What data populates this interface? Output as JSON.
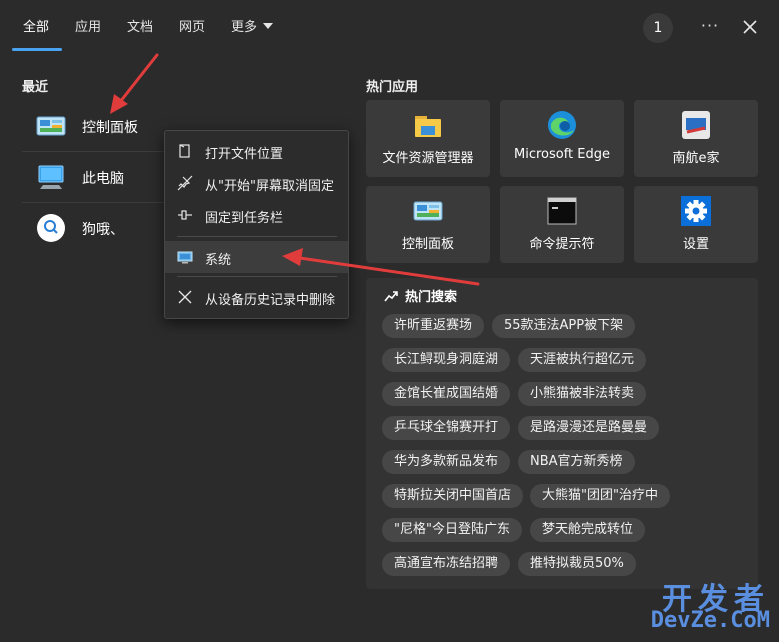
{
  "tabs": [
    {
      "label": "全部"
    },
    {
      "label": "应用"
    },
    {
      "label": "文档"
    },
    {
      "label": "网页"
    },
    {
      "label": "更多"
    }
  ],
  "topbar": {
    "badge": "1",
    "more": "···"
  },
  "recent": {
    "title": "最近",
    "items": [
      {
        "label": "控制面板",
        "icon": "control-panel-icon"
      },
      {
        "label": "此电脑",
        "icon": "this-pc-icon"
      },
      {
        "label": "狗哦、",
        "icon": "search-icon"
      }
    ]
  },
  "context_menu": {
    "items": [
      {
        "label": "打开文件位置",
        "icon": "open-location-icon"
      },
      {
        "label": "从\"开始\"屏幕取消固定",
        "icon": "unpin-icon"
      },
      {
        "label": "固定到任务栏",
        "icon": "pin-taskbar-icon"
      },
      {
        "label": "系统",
        "icon": "system-icon"
      },
      {
        "label": "从设备历史记录中删除",
        "icon": "close-icon"
      }
    ]
  },
  "hot_apps": {
    "title": "热门应用",
    "items": [
      {
        "label": "文件资源管理器",
        "icon": "folder-icon"
      },
      {
        "label": "Microsoft Edge",
        "icon": "edge-icon"
      },
      {
        "label": "南航e家",
        "icon": "app-icon"
      },
      {
        "label": "控制面板",
        "icon": "control-panel-icon"
      },
      {
        "label": "命令提示符",
        "icon": "terminal-icon"
      },
      {
        "label": "设置",
        "icon": "gear-icon"
      }
    ]
  },
  "hot_search": {
    "title": "热门搜索",
    "chips": [
      "许昕重返赛场",
      "55款违法APP被下架",
      "长江鲟现身洞庭湖",
      "天涯被执行超亿元",
      "金馆长崔成国结婚",
      "小熊猫被非法转卖",
      "乒乓球全锦赛开打",
      "是路漫漫还是路曼曼",
      "华为多款新品发布",
      "NBA官方新秀榜",
      "特斯拉关闭中国首店",
      "大熊猫\"团团\"治疗中",
      "\"尼格\"今日登陆广东",
      "梦天舱完成转位",
      "高通宣布冻结招聘",
      "推特拟裁员50%"
    ]
  },
  "watermark": {
    "top": "开发者",
    "bottom": "DevZe.CoM"
  },
  "colors": {
    "accent": "#4aa3f0",
    "annotation_arrow": "#e03c3c",
    "background": "#2b2b2b"
  }
}
